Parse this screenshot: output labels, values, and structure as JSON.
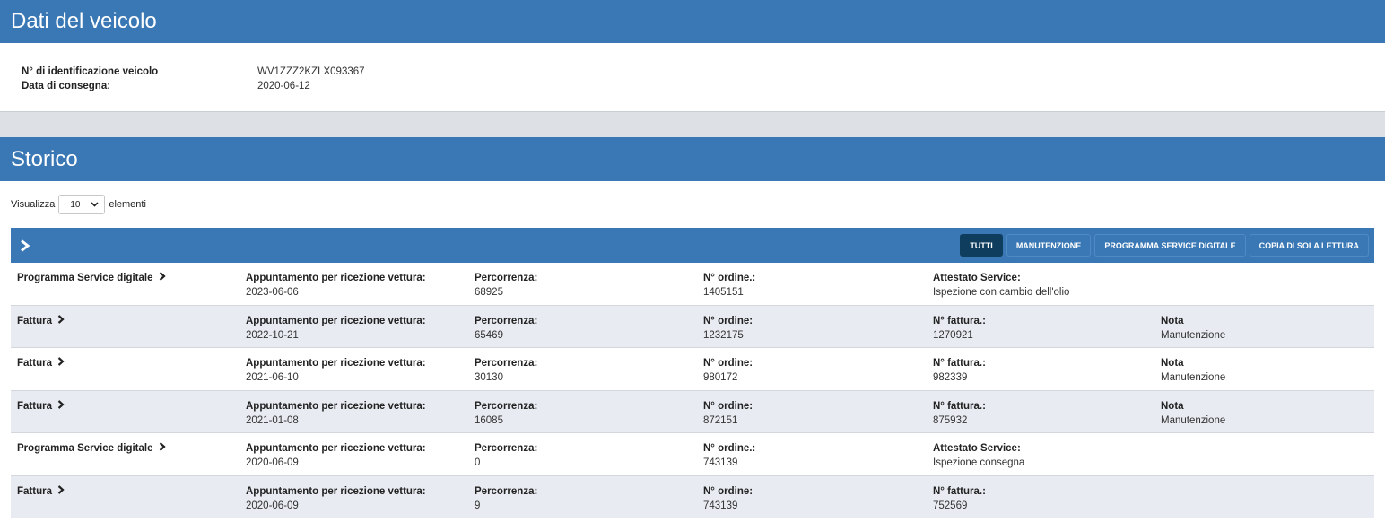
{
  "vehicle": {
    "title": "Dati del veicolo",
    "vin_label": "N° di identificazione veicolo",
    "vin_value": "WV1ZZZ2KZLX093367",
    "delivery_label": "Data di consegna:",
    "delivery_value": "2020-06-12"
  },
  "storico": {
    "title": "Storico",
    "show_label": "Visualizza",
    "page_size": "10",
    "elements_label": "elementi",
    "filters": [
      "TUTTI",
      "MANUTENZIONE",
      "PROGRAMMA SERVICE DIGITALE",
      "COPIA DI SOLA LETTURA"
    ],
    "active_filter": "TUTTI",
    "rows": [
      {
        "type": "Programma Service digitale",
        "appt_label": "Appuntamento per ricezione vettura:",
        "appt_value": "2023-06-06",
        "km_label": "Percorrenza:",
        "km_value": "68925",
        "order_label": "N° ordine.:",
        "order_value": "1405151",
        "c5_label": "Attestato Service:",
        "c5_value": "Ispezione con cambio dell'olio",
        "c6_label": "",
        "c6_value": ""
      },
      {
        "type": "Fattura",
        "appt_label": "Appuntamento per ricezione vettura:",
        "appt_value": "2022-10-21",
        "km_label": "Percorrenza:",
        "km_value": "65469",
        "order_label": "N° ordine:",
        "order_value": "1232175",
        "c5_label": "N° fattura.:",
        "c5_value": "1270921",
        "c6_label": "Nota",
        "c6_value": "Manutenzione"
      },
      {
        "type": "Fattura",
        "appt_label": "Appuntamento per ricezione vettura:",
        "appt_value": "2021-06-10",
        "km_label": "Percorrenza:",
        "km_value": "30130",
        "order_label": "N° ordine:",
        "order_value": "980172",
        "c5_label": "N° fattura.:",
        "c5_value": "982339",
        "c6_label": "Nota",
        "c6_value": "Manutenzione"
      },
      {
        "type": "Fattura",
        "appt_label": "Appuntamento per ricezione vettura:",
        "appt_value": "2021-01-08",
        "km_label": "Percorrenza:",
        "km_value": "16085",
        "order_label": "N° ordine:",
        "order_value": "872151",
        "c5_label": "N° fattura.:",
        "c5_value": "875932",
        "c6_label": "Nota",
        "c6_value": "Manutenzione"
      },
      {
        "type": "Programma Service digitale",
        "appt_label": "Appuntamento per ricezione vettura:",
        "appt_value": "2020-06-09",
        "km_label": "Percorrenza:",
        "km_value": "0",
        "order_label": "N° ordine.:",
        "order_value": "743139",
        "c5_label": "Attestato Service:",
        "c5_value": "Ispezione consegna",
        "c6_label": "",
        "c6_value": ""
      },
      {
        "type": "Fattura",
        "appt_label": "Appuntamento per ricezione vettura:",
        "appt_value": "2020-06-09",
        "km_label": "Percorrenza:",
        "km_value": "9",
        "order_label": "N° ordine:",
        "order_value": "743139",
        "c5_label": "N° fattura.:",
        "c5_value": "752569",
        "c6_label": "",
        "c6_value": ""
      }
    ]
  },
  "icons": {
    "toolbar_expand": "chevron-right-icon",
    "row_detail": "chevron-right-icon",
    "select_dropdown": "chevron-down-icon"
  },
  "colors": {
    "header_blue": "#3a78b5",
    "active_filter": "#0f3d5e",
    "even_row": "#e8ebf1",
    "gap_band": "#dde1e6"
  }
}
